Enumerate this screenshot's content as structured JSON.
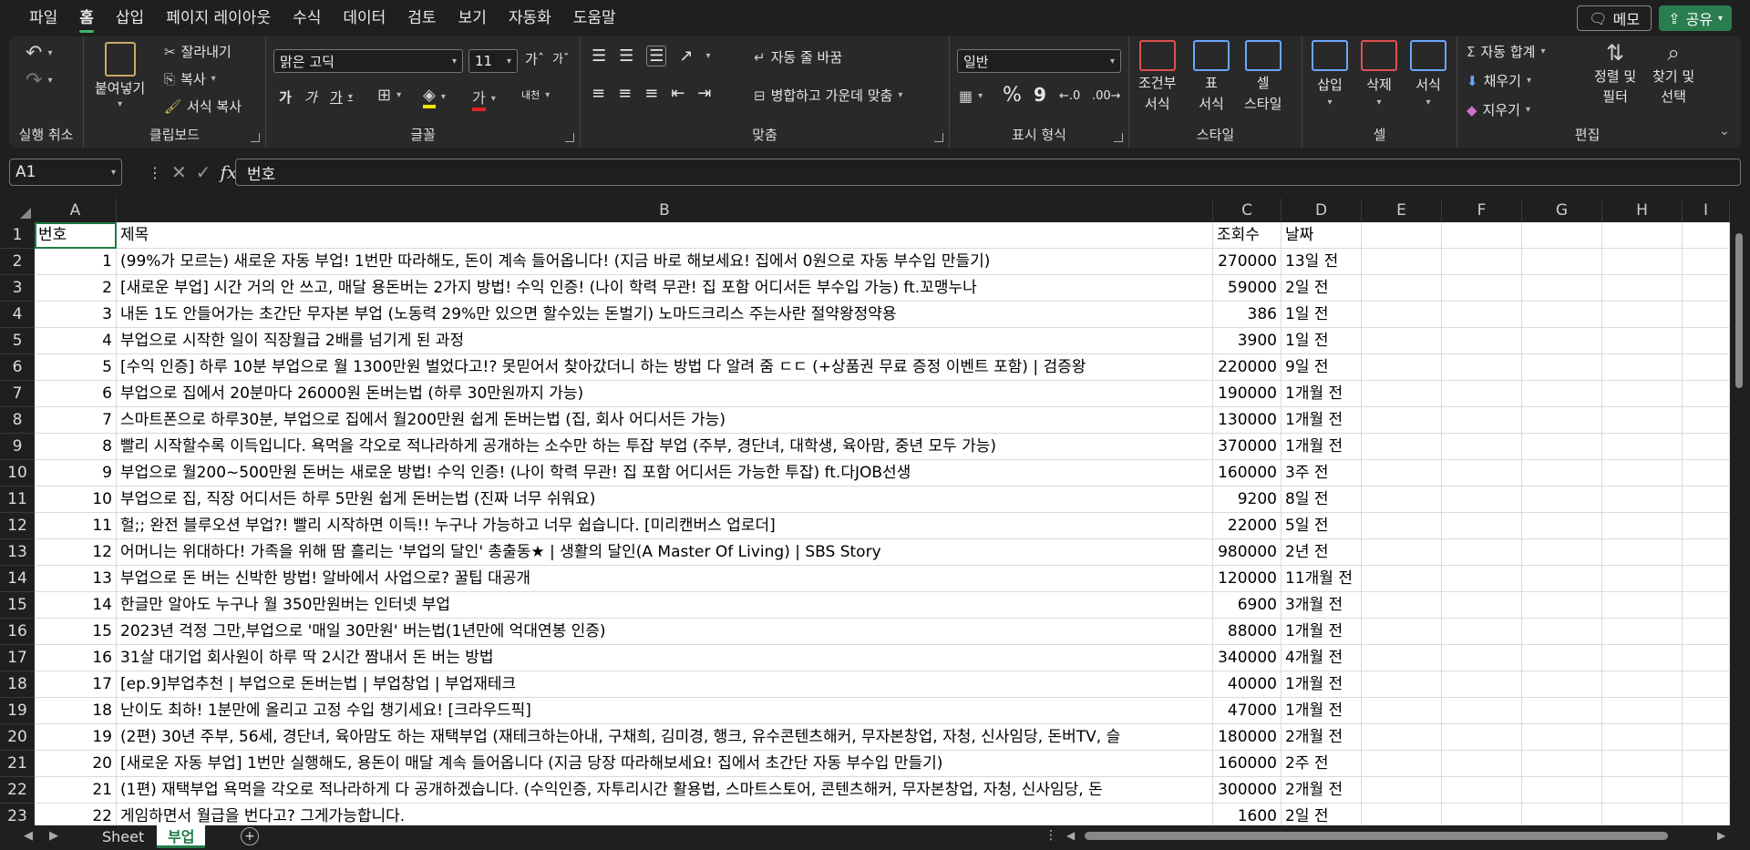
{
  "menu": {
    "items": [
      "파일",
      "홈",
      "삽입",
      "페이지 레이아웃",
      "수식",
      "데이터",
      "검토",
      "보기",
      "자동화",
      "도움말"
    ],
    "active_index": 1,
    "memo_label": "메모",
    "share_label": "공유"
  },
  "ribbon": {
    "undo_group_label": "실행 취소",
    "clipboard": {
      "label": "클립보드",
      "paste": "붙여넣기",
      "cut": "잘라내기",
      "copy": "복사",
      "format_painter": "서식 복사"
    },
    "font": {
      "label": "글꼴",
      "font_name": "맑은 고딕",
      "font_size": "11",
      "bold": "가",
      "italic": "가",
      "underline": "가",
      "phonetic": "내천"
    },
    "alignment": {
      "label": "맞춤",
      "wrap_text": "자동 줄 바꿈",
      "merge_center": "병합하고 가운데 맞춤"
    },
    "number": {
      "label": "표시 형식",
      "format": "일반",
      "percent": "%",
      "comma": "9"
    },
    "styles": {
      "label": "스타일",
      "conditional": [
        "조건부",
        "서식"
      ],
      "table": [
        "표",
        "서식"
      ],
      "cell_style": [
        "셀",
        "스타일"
      ]
    },
    "cells": {
      "label": "셀",
      "insert": "삽입",
      "delete": "삭제",
      "format": "서식"
    },
    "editing": {
      "label": "편집",
      "autosum": "자동 합계",
      "fill": "채우기",
      "clear": "지우기",
      "sort_filter": [
        "정렬 및",
        "필터"
      ],
      "find_select": [
        "찾기 및",
        "선택"
      ]
    }
  },
  "formula_bar": {
    "name_box": "A1",
    "fx": "fx",
    "value": "번호"
  },
  "columns": [
    "A",
    "B",
    "C",
    "D",
    "E",
    "F",
    "G",
    "H",
    "I"
  ],
  "row_numbers": [
    "1",
    "2",
    "3",
    "4",
    "5",
    "6",
    "7",
    "8",
    "9",
    "10",
    "11",
    "12",
    "13",
    "14",
    "15",
    "16",
    "17",
    "18",
    "19",
    "20",
    "21",
    "22",
    "23"
  ],
  "rows": [
    [
      "번호",
      "제목",
      "조회수",
      "날짜"
    ],
    [
      "1",
      "(99%가 모르는) 새로운 자동 부업! 1번만 따라해도, 돈이 계속 들어옵니다! (지금 바로 해보세요! 집에서 0원으로 자동 부수입 만들기)",
      "270000",
      "13일 전"
    ],
    [
      "2",
      "[새로운 부업] 시간 거의 안 쓰고, 매달 용돈버는 2가지 방법! 수익 인증! (나이 학력 무관! 집 포함 어디서든 부수입 가능) ft.꼬맹누나",
      "59000",
      "2일 전"
    ],
    [
      "3",
      "내돈 1도 안들어가는 초간단 무자본 부업 (노동력 29%만 있으면 할수있는 돈벌기) 노마드크리스 주는사란 절약왕정약용",
      "386",
      "1일 전"
    ],
    [
      "4",
      "부업으로 시작한 일이 직장월급 2배를 넘기게 된 과정",
      "3900",
      "1일 전"
    ],
    [
      "5",
      "[수익 인증] 하루 10분 부업으로 월 1300만원 벌었다고!? 못믿어서 찾아갔더니 하는 방법 다 알려 줌 ㄷㄷ (+상품권 무료 증정 이벤트 포함) | 검증왕",
      "220000",
      "9일 전"
    ],
    [
      "6",
      "부업으로 집에서 20분마다 26000원 돈버는법 (하루 30만원까지 가능)",
      "190000",
      "1개월 전"
    ],
    [
      "7",
      "스마트폰으로 하루30분, 부업으로 집에서 월200만원 쉽게 돈버는법 (집, 회사 어디서든 가능)",
      "130000",
      "1개월 전"
    ],
    [
      "8",
      "빨리 시작할수록 이득입니다. 욕먹을 각오로 적나라하게 공개하는 소수만 하는 투잡 부업 (주부, 경단녀, 대학생, 육아맘, 중년 모두 가능)",
      "370000",
      "1개월 전"
    ],
    [
      "9",
      "부업으로 월200~500만원 돈버는 새로운 방법! 수익 인증! (나이 학력 무관! 집 포함 어디서든 가능한 투잡) ft.다JOB선생",
      "160000",
      "3주 전"
    ],
    [
      "10",
      "부업으로 집, 직장 어디서든 하루 5만원 쉽게 돈버는법 (진짜 너무 쉬워요)",
      "9200",
      "8일 전"
    ],
    [
      "11",
      "헐;; 완전 블루오션 부업?! 빨리 시작하면 이득!! 누구나 가능하고 너무 쉽습니다. [미리캔버스 업로더]",
      "22000",
      "5일 전"
    ],
    [
      "12",
      "어머니는 위대하다! 가족을 위해 땀 흘리는 '부업의 달인' 총출동★ | 생활의 달인(A Master Of Living) | SBS Story",
      "980000",
      "2년 전"
    ],
    [
      "13",
      "부업으로 돈 버는 신박한 방법! 알바에서 사업으로? 꿀팁 대공개",
      "120000",
      "11개월 전"
    ],
    [
      "14",
      "한글만 알아도 누구나 월 350만원버는 인터넷 부업",
      "6900",
      "3개월 전"
    ],
    [
      "15",
      "2023년 걱정 그만,부업으로 '매일 30만원' 버는법(1년만에 억대연봉 인증)",
      "88000",
      "1개월 전"
    ],
    [
      "16",
      "31살 대기업 회사원이 하루 딱 2시간 짬내서 돈 버는 방법",
      "340000",
      "4개월 전"
    ],
    [
      "17",
      "[ep.9]부업추천 | 부업으로 돈버는법 | 부업창업 | 부업재테크",
      "40000",
      "1개월 전"
    ],
    [
      "18",
      "난이도 최하! 1분만에 올리고 고정 수입 챙기세요! [크라우드픽]",
      "47000",
      "1개월 전"
    ],
    [
      "19",
      "(2편) 30년 주부, 56세, 경단녀, 육아맘도 하는 재택부업 (재테크하는아내, 구채희, 김미경, 행크, 유수콘텐츠해커, 무자본창업, 자청, 신사임당, 돈버TV, 슬",
      "180000",
      "2개월 전"
    ],
    [
      "20",
      "[새로운 자동 부업] 1번만 실행해도, 용돈이 매달 계속 들어옵니다 (지금 당장 따라해보세요! 집에서 초간단 자동 부수입 만들기)",
      "160000",
      "2주 전"
    ],
    [
      "21",
      "(1편) 재택부업 욕먹을 각오로 적나라하게 다 공개하겠습니다. (수익인증, 자투리시간 활용법, 스마트스토어, 콘텐츠해커, 무자본창업, 자청, 신사임당, 돈",
      "300000",
      "2개월 전"
    ],
    [
      "22",
      "게임하면서 월급을 번다고? 그게가능합니다.",
      "1600",
      "2일 전"
    ]
  ],
  "sheet_tabs": [
    "Sheet",
    "부업"
  ],
  "active_tab": 1,
  "colors": {
    "accent": "#1f7a45",
    "share": "#2a7d4f"
  }
}
